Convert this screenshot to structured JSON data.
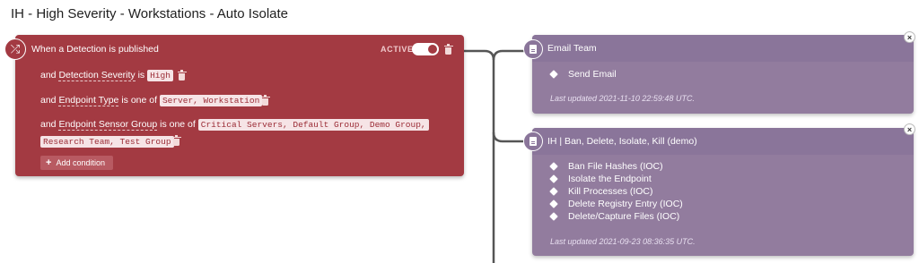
{
  "page": {
    "title": "IH - High Severity - Workstations - Auto Isolate"
  },
  "trigger": {
    "title": "When a Detection is published",
    "status_label": "ACTIVE",
    "status_active": true,
    "icon": "shuffle-icon",
    "conditions": [
      {
        "prefix": "and",
        "field": "Detection Severity",
        "op": "is",
        "value": "High"
      },
      {
        "prefix": "and",
        "field": "Endpoint Type",
        "op": "is one of",
        "value": "Server, Workstation"
      },
      {
        "prefix": "and",
        "field": "Endpoint Sensor Group",
        "op": "is one of",
        "value_line1": "Critical Servers, Default Group, Demo Group,",
        "value_line2": "Research Team, Test Group"
      }
    ],
    "add_condition_label": "Add condition"
  },
  "actions": [
    {
      "title": "Email Team",
      "steps": [
        "Send Email"
      ],
      "last_updated": "Last updated 2021-11-10 22:59:48 UTC."
    },
    {
      "title": "IH | Ban, Delete, Isolate, Kill (demo)",
      "steps": [
        "Ban File Hashes (IOC)",
        "Isolate the Endpoint",
        "Kill Processes (IOC)",
        "Delete Registry Entry (IOC)",
        "Delete/Capture Files (IOC)"
      ],
      "last_updated": "Last updated 2021-09-23 08:36:35 UTC."
    }
  ],
  "colors": {
    "trigger": "#a33a42",
    "action": "#927c9e",
    "connector": "#555555"
  },
  "icons": {
    "close": "×",
    "plus": "+"
  }
}
